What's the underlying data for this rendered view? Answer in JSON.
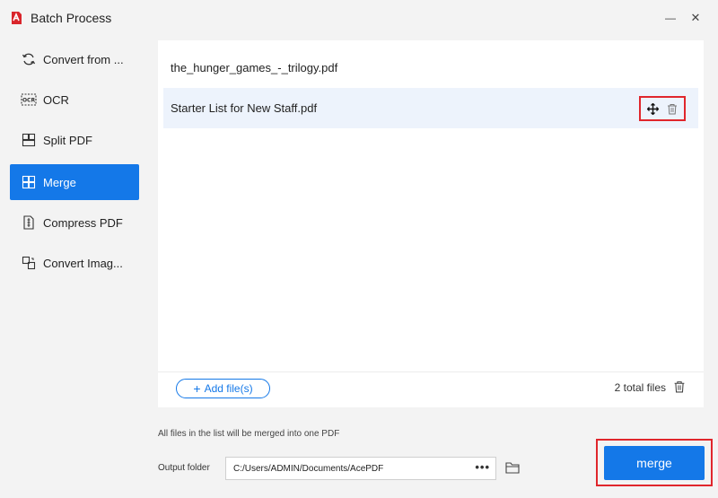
{
  "window": {
    "title": "Batch Process",
    "minimize_glyph": "—",
    "close_glyph": "✕"
  },
  "sidebar": {
    "items": [
      {
        "label": "Convert from ...",
        "icon": "refresh-icon",
        "active": false
      },
      {
        "label": "OCR",
        "icon": "ocr-icon",
        "active": false
      },
      {
        "label": "Split PDF",
        "icon": "split-icon",
        "active": false
      },
      {
        "label": "Merge",
        "icon": "merge-icon",
        "active": true
      },
      {
        "label": "Compress PDF",
        "icon": "compress-icon",
        "active": false
      },
      {
        "label": "Convert Imag...",
        "icon": "image-convert-icon",
        "active": false
      }
    ]
  },
  "files": [
    {
      "name": "the_hunger_games_-_trilogy.pdf",
      "selected": false
    },
    {
      "name": "Starter List for New Staff.pdf",
      "selected": true
    }
  ],
  "footer": {
    "add_files_label": "Add file(s)",
    "total_files": "2 total files"
  },
  "info_text": "All files in the list will be merged into one PDF",
  "output": {
    "label": "Output folder",
    "path": "C:/Users/ADMIN/Documents/AcePDF",
    "more": "•••"
  },
  "merge_button_label": "merge",
  "colors": {
    "accent": "#1478e8",
    "highlight_border": "#e0262c",
    "selected_row": "#edf3fc"
  }
}
